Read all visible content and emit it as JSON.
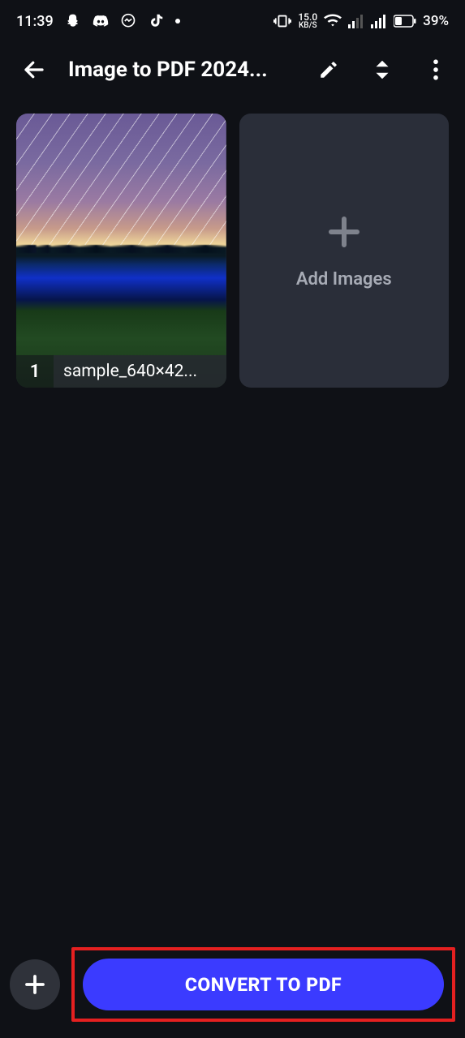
{
  "status": {
    "time": "11:39",
    "network_speed_top": "15.0",
    "network_speed_bottom": "KB/S",
    "battery_text": "39%"
  },
  "header": {
    "title": "Image to PDF 2024..."
  },
  "grid": {
    "image_tile": {
      "index": "1",
      "filename": "sample_640×42..."
    },
    "add_tile": {
      "label": "Add Images"
    }
  },
  "bottom": {
    "convert_label": "CONVERT TO PDF"
  }
}
